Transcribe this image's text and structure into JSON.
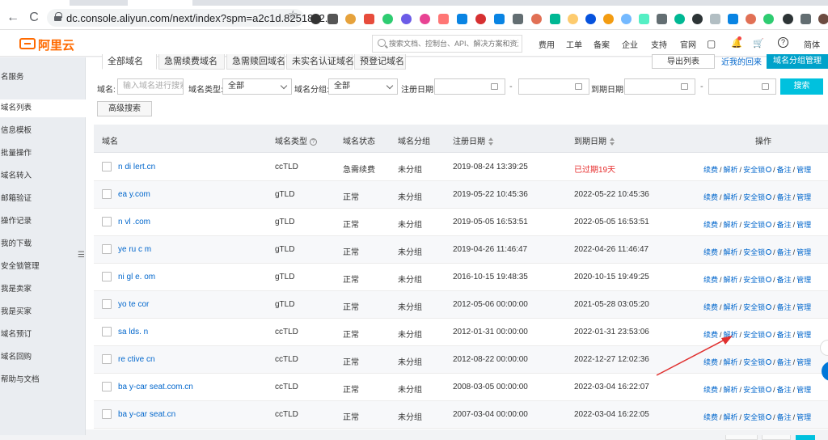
{
  "browser": {
    "url": "dc.console.aliyun.com/next/index?spm=a2c1d.8251892...",
    "nav_back": "←",
    "nav_forward": "→",
    "nav_reload": "C",
    "star": "☆"
  },
  "header": {
    "logo_text": "阿里云",
    "search_placeholder": "搜索文档、控制台、API、解决方案和资源",
    "nav": [
      "费用",
      "工单",
      "备案",
      "企业",
      "支持",
      "官网"
    ],
    "bell": "🔔",
    "cart": "🛒",
    "help": "?",
    "lang": "简体"
  },
  "sidebar": {
    "items": [
      {
        "label": "名服务"
      },
      {
        "label": "域名列表"
      },
      {
        "label": "信息模板"
      },
      {
        "label": "批量操作"
      },
      {
        "label": "域名转入"
      },
      {
        "label": "邮箱验证"
      },
      {
        "label": "操作记录"
      },
      {
        "label": "我的下载"
      },
      {
        "label": "安全锁管理"
      },
      {
        "label": "我是卖家"
      },
      {
        "label": "我是买家"
      },
      {
        "label": "域名预订"
      },
      {
        "label": "域名回购"
      },
      {
        "label": "帮助与文档"
      }
    ],
    "toggle": "☰"
  },
  "tabs": [
    "全部域名",
    "急需续费域名",
    "急需赎回域名",
    "未实名认证域名",
    "预登记域名"
  ],
  "actions": {
    "export": "导出列表",
    "domain_list_link": "近我的回来",
    "group_manage": "域名分组管理"
  },
  "filters": {
    "name_label": "域名:",
    "name_placeholder": "输入域名进行搜索",
    "type_label": "域名类型:",
    "type_value": "全部",
    "group_label": "域名分组:",
    "group_value": "全部",
    "reg_label": "注册日期:",
    "exp_label": "到期日期:",
    "dash": "-",
    "search_button": "搜索",
    "advanced_button": "高级搜索"
  },
  "table": {
    "headers": {
      "domain": "域名",
      "type": "域名类型",
      "status": "域名状态",
      "group": "域名分组",
      "reg_date": "注册日期",
      "exp_date": "到期日期",
      "ops": "操作"
    },
    "op_labels": {
      "renew": "续费",
      "dns": "解析",
      "lock": "安全锁",
      "note": "备注",
      "manage": "管理",
      "sep": "/"
    },
    "rows": [
      {
        "domain": "n  di  lert.cn",
        "type": "ccTLD",
        "status": "急需续费",
        "group": "未分组",
        "reg": "2019-08-24 13:39:25",
        "exp": "已过期19天",
        "expired": true
      },
      {
        "domain": "ea     y.com",
        "type": "gTLD",
        "status": "正常",
        "group": "未分组",
        "reg": "2019-05-22 10:45:36",
        "exp": "2022-05-22 10:45:36",
        "expired": false
      },
      {
        "domain": "n  vl  .com",
        "type": "gTLD",
        "status": "正常",
        "group": "未分组",
        "reg": "2019-05-05 16:53:51",
        "exp": "2022-05-05 16:53:51",
        "expired": false
      },
      {
        "domain": "ye  ru  c  m",
        "type": "gTLD",
        "status": "正常",
        "group": "未分组",
        "reg": "2019-04-26 11:46:47",
        "exp": "2022-04-26 11:46:47",
        "expired": false
      },
      {
        "domain": "ni  gl  e.  om",
        "type": "gTLD",
        "status": "正常",
        "group": "未分组",
        "reg": "2016-10-15 19:48:35",
        "exp": "2020-10-15 19:49:25",
        "expired": false
      },
      {
        "domain": "yo  te  cor",
        "type": "gTLD",
        "status": "正常",
        "group": "未分组",
        "reg": "2012-05-06 00:00:00",
        "exp": "2021-05-28 03:05:20",
        "expired": false
      },
      {
        "domain": "sa    lds.  n",
        "type": "ccTLD",
        "status": "正常",
        "group": "未分组",
        "reg": "2012-01-31 00:00:00",
        "exp": "2022-01-31 23:53:06",
        "expired": false
      },
      {
        "domain": "re   ctive  cn",
        "type": "ccTLD",
        "status": "正常",
        "group": "未分组",
        "reg": "2012-08-22 00:00:00",
        "exp": "2022-12-27 12:02:36",
        "expired": false
      },
      {
        "domain": "ba  y-car  seat.com.cn",
        "type": "ccTLD",
        "status": "正常",
        "group": "未分组",
        "reg": "2008-03-05 00:00:00",
        "exp": "2022-03-04 16:22:07",
        "expired": false
      },
      {
        "domain": "ba  y-car  seat.cn",
        "type": "ccTLD",
        "status": "正常",
        "group": "未分组",
        "reg": "2007-03-04 00:00:00",
        "exp": "2022-03-04 16:22:05",
        "expired": false
      }
    ]
  },
  "colors": {
    "brand": "#ff6a00",
    "link": "#0066cc",
    "primary_button": "#00c1de",
    "expired": "#e72d2d",
    "annotation_arrow": "#e0302f"
  }
}
